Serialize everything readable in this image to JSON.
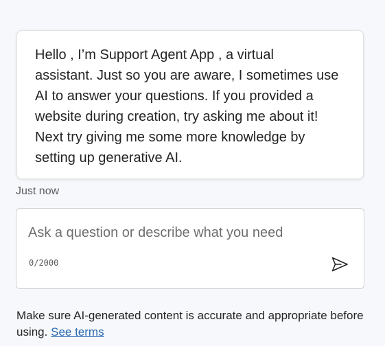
{
  "conversation": {
    "bot_message": "Hello , I’m Support Agent App , a virtual\nassistant. Just so you are aware, I sometimes use\nAI to answer your questions. If you provided a\nwebsite during creation, try asking me about it!\nNext try giving me some more knowledge by\nsetting up generative AI.",
    "timestamp": "Just now"
  },
  "composer": {
    "placeholder": "Ask a question or describe what you need",
    "value": "",
    "char_count": "0/2000",
    "send_icon": "send-icon"
  },
  "footer": {
    "disclaimer_text": "Make sure AI-generated content is accurate and appropriate before using.",
    "terms_link": "See terms"
  },
  "colors": {
    "background": "#f7f8fc",
    "link": "#2b6cb0",
    "text": "#242424"
  }
}
